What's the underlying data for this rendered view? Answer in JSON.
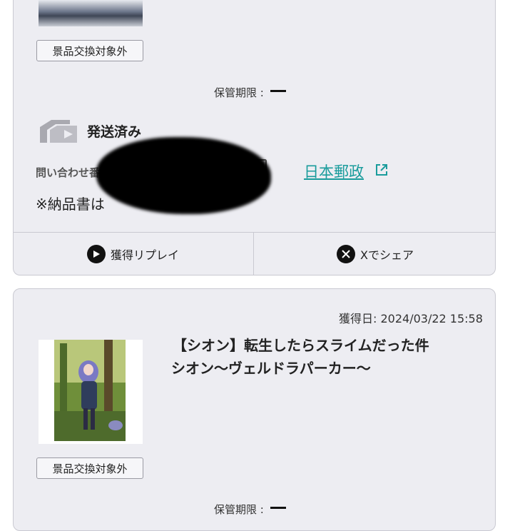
{
  "prize1": {
    "badge": "景品交換対象外",
    "storage_label": "保管期限 :",
    "shipping_status": "発送済み",
    "inquiry_label": "問い合わせ番",
    "carrier_link": "日本郵政",
    "note": "※納品書は"
  },
  "actions": {
    "replay_label": "獲得リプレイ",
    "share_label": "Xでシェア"
  },
  "prize2": {
    "obtained_date": "獲得日: 2024/03/22 15:58",
    "title_line1": "【シオン】転生したらスライムだった件",
    "title_line2": "シオン〜ヴェルドラパーカー〜",
    "badge": "景品交換対象外",
    "storage_label": "保管期限 :"
  }
}
